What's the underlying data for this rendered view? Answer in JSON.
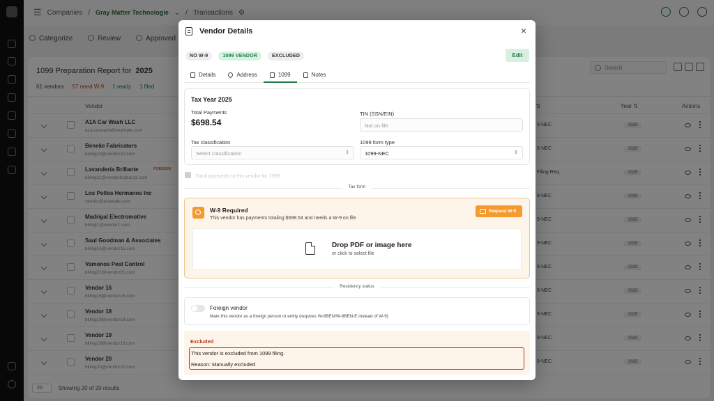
{
  "topbar": {
    "breadcrumb_companies": "Companies",
    "company": "Gray Matter Technologie",
    "transactions": "Transactions"
  },
  "subnav": {
    "categorize": "Categorize",
    "review": "Review",
    "approved": "Approved"
  },
  "report": {
    "title": "1099 Preparation Report for",
    "year": "2025",
    "stats": {
      "vendors": "61 vendors",
      "need_w9": "57 need W-9",
      "ready": "1 ready",
      "filed": "1 filed"
    },
    "search_placeholder": "Search"
  },
  "table": {
    "columns": {
      "vendor": "Vendor",
      "type": "e ⇅",
      "year": "Year ⇅",
      "actions": "Actions"
    },
    "rows": [
      {
        "name": "A1A Car Wash LLC",
        "email": "a1a.carwash@example.com",
        "type": "9-NEC",
        "year": "2025"
      },
      {
        "name": "Beneke Fabricators",
        "email": "billing10@vendor10.com",
        "type": "9-NEC",
        "year": "2025"
      },
      {
        "name": "Lavanderia Brillante",
        "email": "billing11@vendorfoobar11.com",
        "type": "Filing Req.",
        "year": "2025",
        "tag": "FOREIGN"
      },
      {
        "name": "Los Pollos Hermanos Inc",
        "email": "vendor@example.com",
        "type": "9-NEC",
        "year": "2025"
      },
      {
        "name": "Madrigal Electromotive",
        "email": "billing1@vendor1.com",
        "type": "9-NEC",
        "year": "2025"
      },
      {
        "name": "Saul Goodman & Associates",
        "email": "billing15@vendor15.com",
        "type": "9-NEC",
        "year": "2025"
      },
      {
        "name": "Vamonos Pest Control",
        "email": "billing21@vendor21.com",
        "type": "9-NEC",
        "year": "2025"
      },
      {
        "name": "Vendor 16",
        "email": "billing16@vendor16.com",
        "type": "9-NEC",
        "year": "2025"
      },
      {
        "name": "Vendor 18",
        "email": "billing18@vendor18.com",
        "type": "9-NEC",
        "year": "2025"
      },
      {
        "name": "Vendor 19",
        "email": "billing19@vendor19.com",
        "type": "9-NEC",
        "year": "2025"
      },
      {
        "name": "Vendor 20",
        "email": "billing20@vendor20.com",
        "type": "9-NEC",
        "year": "2025"
      }
    ],
    "footer": {
      "page_size": "20",
      "showing": "Showing 20 of 20 results"
    }
  },
  "modal": {
    "title": "Vendor Details",
    "close": "×",
    "badges": [
      "NO W-9",
      "1099 VENDOR",
      "EXCLUDED"
    ],
    "edit": "Edit",
    "tabs": [
      "Details",
      "Address",
      "1099",
      "Notes"
    ],
    "tax": {
      "heading": "Tax Year 2025",
      "total_label": "Total Payments",
      "total_value": "$698.54",
      "tin_label": "TIN (SSN/EIN)",
      "tin_value": "Not on file",
      "class_label": "Tax classification",
      "class_placeholder": "Select classification",
      "form_label": "1099 form type",
      "form_value": "1099-NEC"
    },
    "track_label": "Track payments to this vendor for 1099",
    "tax_form_divider": "Tax form",
    "w9": {
      "title": "W-9 Required",
      "desc": "This vendor has payments totaling $698.54 and needs a W-9 on file",
      "button": "Request W-9",
      "drop_title": "Drop PDF or image here",
      "drop_sub": "or click to select file"
    },
    "residency_divider": "Residency status",
    "foreign": {
      "title": "Foreign vendor",
      "desc": "Mark this vendor as a foreign person or entity (requires W-8BEN/W-8BEN-E instead of W-9)"
    },
    "excluded": {
      "title": "Excluded",
      "line1": "This vendor is excluded from 1099 filing.",
      "line2": "Reason: Manually excluded"
    }
  }
}
